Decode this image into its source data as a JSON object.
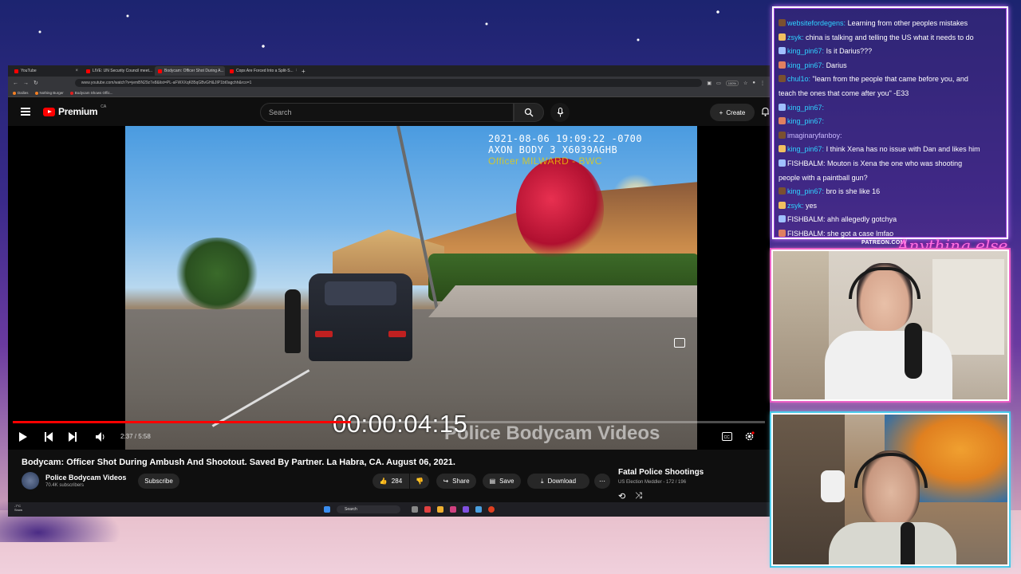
{
  "browser": {
    "tabs": [
      {
        "label": "YouTube",
        "active": false
      },
      {
        "label": "LIVE: UN Security Council meet...",
        "active": false
      },
      {
        "label": "Bodycam: Officer Shot During A...",
        "active": true
      },
      {
        "label": "Cops Are Forced Into a Split-S...",
        "active": false
      }
    ],
    "url": "www.youtube.com/watch?v=jemBN29z7e8&list=PL-aFWXXqK85qGBvGH&JIP1bt0agchh&rco=1",
    "zoom": "100%",
    "bookmarks": [
      "Dailies",
      "Nothing Burger",
      "Bodycam Shows Offic..."
    ]
  },
  "youtube": {
    "logo_text": "Premium",
    "region": "CA",
    "search_placeholder": "Search",
    "create_label": "Create"
  },
  "video": {
    "stamp_line1": "2021-08-06 19:09:22 -0700",
    "stamp_line2": "AXON BODY 3 X6039AGHB",
    "stamp_line3": "Officer MILWARD - BWC",
    "timecode": "00:00:04:15",
    "watermark": "Police Bodycam Videos",
    "time_display": "2:37 / 5:58",
    "progress": 0.45,
    "title": "Bodycam: Officer Shot During Ambush And Shootout. Saved By Partner. La Habra, CA. August 06, 2021.",
    "channel_name": "Police Bodycam Videos",
    "channel_subs": "70.4K subscribers",
    "subscribe_label": "Subscribe",
    "like_count": "284",
    "share_label": "Share",
    "save_label": "Save",
    "download_label": "Download"
  },
  "playlist": {
    "title": "Fatal Police Shootings",
    "subtitle": "US Election Meddler - 172 / 196"
  },
  "taskbar": {
    "search_label": "Search",
    "weather_line1": "-7°C",
    "weather_line2": "Snow"
  },
  "chat": {
    "messages": [
      {
        "user": "websitefordegens:",
        "text": "Learning from other peoples mistakes",
        "color": "cyan"
      },
      {
        "user": "zsyk:",
        "text": "china is talking and telling the US what it needs to do",
        "color": "cyan"
      },
      {
        "user": "king_pin67:",
        "text": "Is it Darius???",
        "color": "cyan"
      },
      {
        "user": "king_pin67:",
        "text": "Darius",
        "color": "cyan"
      },
      {
        "user": "chul1o:",
        "text": "\"learn from the people that came before you, and",
        "color": "cyan"
      },
      {
        "user": "",
        "text": "teach the ones that come after you\" -E33",
        "color": "cyan"
      },
      {
        "user": "king_pin67:",
        "text": "",
        "color": "cyan"
      },
      {
        "user": "king_pin67:",
        "text": "",
        "color": "cyan"
      },
      {
        "user": "imaginaryfanboy:",
        "text": "",
        "color": "gray"
      },
      {
        "user": "king_pin67:",
        "text": "I think Xena has no issue with Dan and likes him",
        "color": "cyan"
      },
      {
        "user": "FISHBALM:",
        "text": "Mouton is Xena the one who was shooting",
        "color": "white"
      },
      {
        "user": "",
        "text": "people with a paintball gun?",
        "color": "white"
      },
      {
        "user": "king_pin67:",
        "text": "bro is she like 16",
        "color": "cyan"
      },
      {
        "user": "zsyk:",
        "text": "yes",
        "color": "cyan"
      },
      {
        "user": "FISHBALM:",
        "text": "ahh allegedly gotchya",
        "color": "white"
      },
      {
        "user": "FISHBALM:",
        "text": "she got a case lmfao",
        "color": "white"
      }
    ]
  },
  "overlay": {
    "patreon": "PATREON.COM/",
    "script_name": "Anything else"
  },
  "colors": {
    "yt_red": "#ff0000",
    "chat_user": "#2fd2ff",
    "cam1_border": "#e050c0",
    "cam2_border": "#40c0e0"
  }
}
